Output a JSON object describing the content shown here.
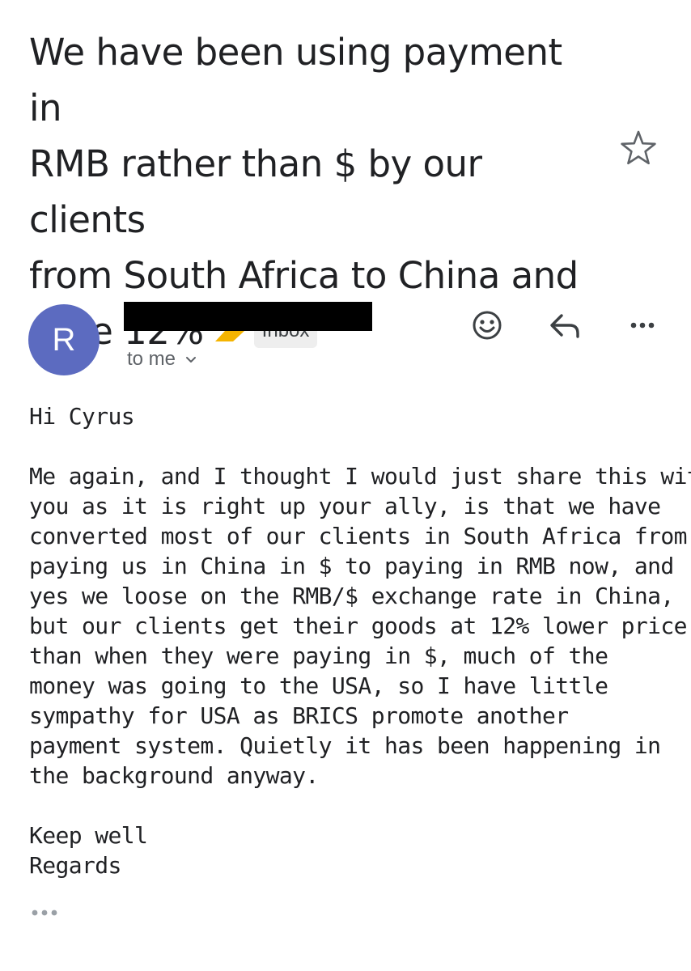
{
  "email": {
    "subject_lines": [
      "We have been using payment in",
      "RMB rather than $ by our clients",
      "from South Africa to China and",
      "save 12%"
    ],
    "label": "Inbox",
    "sender_initial": "R",
    "recipient": "to me",
    "body": {
      "greeting": "Hi Cyrus",
      "paragraph_lines": [
        "Me again, and I thought I would just share this with",
        "you as it is right up your ally, is that we have",
        "converted most of our clients in South Africa from",
        "paying us in China in $ to paying in RMB now, and",
        "yes we loose on the RMB/$ exchange rate in China,",
        "but our clients get their goods at 12% lower price",
        "than when they were paying in $, much of the",
        "money was going to the USA, so I have little",
        "sympathy for USA as BRICS promote another",
        "payment system. Quietly it has been happening in",
        "the background anyway."
      ],
      "signoff_lines": [
        "Keep well",
        "Regards"
      ]
    }
  },
  "icons": {
    "importance": "importance-marker-icon",
    "star": "star-icon",
    "emoji": "add-reaction-icon",
    "reply": "reply-icon",
    "more": "more-options-icon",
    "expand": "chevron-down-icon",
    "trimmed": "show-trimmed-content-icon"
  },
  "colors": {
    "avatar_bg": "#5c6bc0",
    "importance": "#f5b400",
    "chip_bg": "#eeeeee",
    "icon": "#5f6368"
  }
}
